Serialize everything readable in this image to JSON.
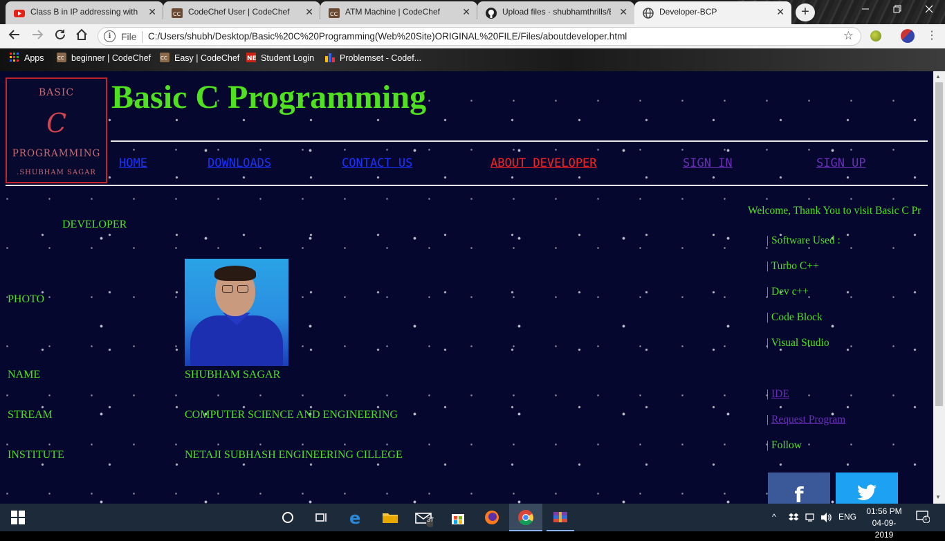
{
  "browser": {
    "tabs": [
      {
        "title": "Class B in IP addressing with E",
        "icon": "youtube-icon"
      },
      {
        "title": "CodeChef User | CodeChef",
        "icon": "codechef-icon"
      },
      {
        "title": "ATM Machine | CodeChef",
        "icon": "codechef-icon"
      },
      {
        "title": "Upload files · shubhamthrills/B",
        "icon": "github-icon"
      },
      {
        "title": "Developer-BCP",
        "icon": "globe-icon"
      }
    ],
    "active_tab": 4,
    "close_glyph": "✕",
    "new_tab_glyph": "+",
    "file_label": "File",
    "url": "C:/Users/shubh/Desktop/Basic%20C%20Programming(Web%20Site)ORIGINAL%20FILE/Files/aboutdeveloper.html",
    "bookmarks": [
      {
        "label": "Apps",
        "icon": "apps-grid-icon"
      },
      {
        "label": "beginner | CodeChef",
        "icon": "codechef-icon"
      },
      {
        "label": "Easy | CodeChef",
        "icon": "codechef-icon"
      },
      {
        "label": "Student Login",
        "icon": "ne-icon"
      },
      {
        "label": "Problemset - Codef...",
        "icon": "codeforces-icon"
      }
    ]
  },
  "page": {
    "logo": {
      "line1": "BASIC",
      "line2": "C",
      "line3": "PROGRAMMING",
      "line4": ".SHUBHAM SAGAR"
    },
    "title": "Basic C Programming",
    "nav": [
      {
        "label": "HOME",
        "state": "link"
      },
      {
        "label": "DOWNLOADS",
        "state": "link"
      },
      {
        "label": "CONTACT US",
        "state": "link"
      },
      {
        "label": "ABOUT DEVELOPER",
        "state": "current"
      },
      {
        "label": "SIGN IN",
        "state": "visited"
      },
      {
        "label": "SIGN UP",
        "state": "visited"
      }
    ],
    "section_heading": "DEVELOPER",
    "details": {
      "photo_label": "PHOTO",
      "name_label": "NAME",
      "name_value": "SHUBHAM SAGAR",
      "stream_label": "STREAM",
      "stream_value": "COMPUTER SCIENCE AND ENGINEERING",
      "institute_label": "INSTITUTE",
      "institute_value": "NETAJI SUBHASH ENGINEERING CILLEGE"
    },
    "marquee": "Welcome, Thank You to visit Basic C Pr",
    "sidebar": {
      "software_heading": "| Software Used :",
      "software": [
        "| Turbo C++",
        "| Dev c++",
        "| Code Block",
        "| Visual Studio"
      ],
      "sep": "|",
      "ide_link": "IDE",
      "request_link": "Request Program",
      "follow": "| Follow",
      "facebook_glyph": "f",
      "twitter_glyph": "🐦"
    },
    "colors": {
      "background": "#05072e",
      "accent_green": "#4fe020",
      "link_blue": "#1a32ff",
      "current_red": "#ff2020",
      "visited_purple": "#6a2eb8",
      "logo_red": "#c0252b"
    }
  },
  "taskbar": {
    "mail_badge": "37",
    "language": "ENG",
    "time": "01:56 PM",
    "date": "04-09-2019",
    "notification_count": "1"
  }
}
